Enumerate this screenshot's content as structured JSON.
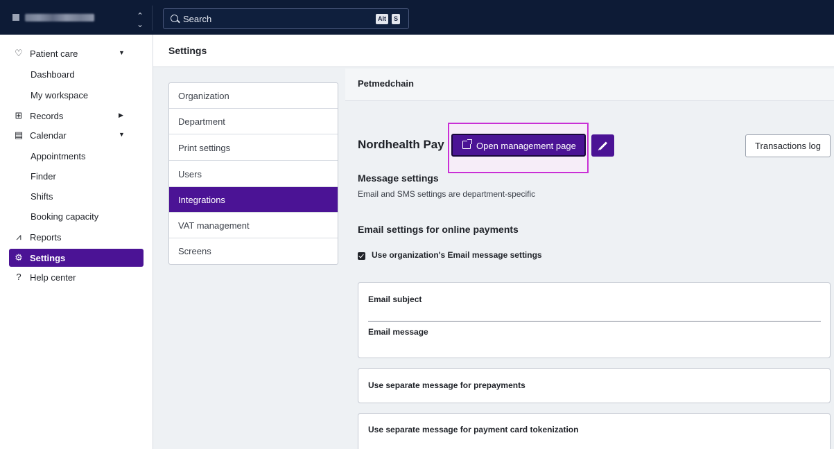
{
  "topbar": {
    "search": {
      "placeholder": "Search",
      "shortcut_keys": [
        "Alt",
        "S"
      ]
    }
  },
  "sidebar": {
    "items": [
      {
        "label": "Patient care",
        "icon": "heart-pulse-icon",
        "expanded": true
      },
      {
        "label": "Dashboard",
        "sub": true
      },
      {
        "label": "My workspace",
        "sub": true
      },
      {
        "label": "Records",
        "icon": "records-icon",
        "expanded": false
      },
      {
        "label": "Calendar",
        "icon": "calendar-icon",
        "expanded": true
      },
      {
        "label": "Appointments",
        "sub": true
      },
      {
        "label": "Finder",
        "sub": true
      },
      {
        "label": "Shifts",
        "sub": true
      },
      {
        "label": "Booking capacity",
        "sub": true
      },
      {
        "label": "Reports",
        "icon": "chart-line-icon"
      },
      {
        "label": "Settings",
        "icon": "gear-icon",
        "active": true
      },
      {
        "label": "Help center",
        "icon": "help-circle-icon"
      }
    ]
  },
  "main": {
    "title": "Settings",
    "menu": [
      {
        "label": "Organization"
      },
      {
        "label": "Department"
      },
      {
        "label": "Print settings"
      },
      {
        "label": "Users"
      },
      {
        "label": "Integrations",
        "active": true
      },
      {
        "label": "VAT management"
      },
      {
        "label": "Screens"
      }
    ],
    "content": {
      "org_name": "Petmedchain",
      "pay_title": "Nordhealth Pay",
      "open_button": "Open management page",
      "transactions_button": "Transactions log",
      "message_settings_title": "Message settings",
      "message_settings_desc": "Email and SMS settings are department-specific",
      "email_settings_title": "Email settings for online payments",
      "use_org_email_label": "Use organization's Email message settings",
      "use_org_email_checked": true,
      "email_subject_label": "Email subject",
      "email_message_label": "Email message",
      "prepayments_label": "Use separate message for prepayments",
      "tokenization_label": "Use separate message for payment card tokenization"
    }
  },
  "colors": {
    "accent": "#4b1395",
    "topbar": "#0d1b36",
    "highlight": "#c92fd6"
  }
}
